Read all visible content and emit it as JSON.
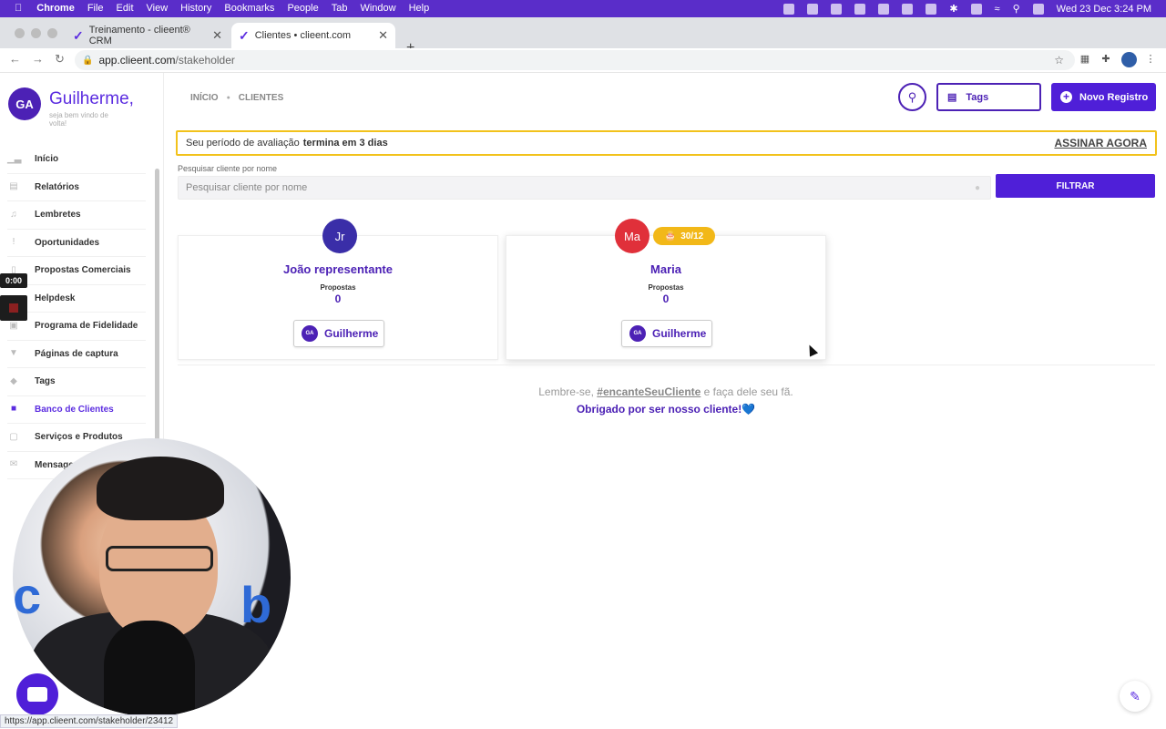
{
  "menubar": {
    "app": "Chrome",
    "items": [
      "File",
      "Edit",
      "View",
      "History",
      "Bookmarks",
      "People",
      "Tab",
      "Window",
      "Help"
    ],
    "clock": "Wed 23 Dec  3:24 PM"
  },
  "tabs": [
    {
      "title": "Treinamento - clieent® CRM",
      "active": false
    },
    {
      "title": "Clientes • clieent.com",
      "active": true
    }
  ],
  "address": {
    "host": "app.clieent.com",
    "path": "/stakeholder"
  },
  "sidebar": {
    "initials": "GA",
    "greeting": "Guilherme,",
    "subtitle": "seja bem vindo de volta!",
    "items": [
      {
        "label": "Início"
      },
      {
        "label": "Relatórios"
      },
      {
        "label": "Lembretes"
      },
      {
        "label": "Oportunidades"
      },
      {
        "label": "Propostas Comerciais"
      },
      {
        "label": "Helpdesk"
      },
      {
        "label": "Programa de Fidelidade"
      },
      {
        "label": "Páginas de captura"
      },
      {
        "label": "Tags"
      },
      {
        "label": "Banco de Clientes"
      },
      {
        "label": "Serviços e Produtos"
      },
      {
        "label": "Mensagem"
      }
    ],
    "active_index": 9
  },
  "recorder": {
    "time": "0:00"
  },
  "header": {
    "breadcrumb": [
      "INÍCIO",
      "CLIENTES"
    ],
    "tags_label": "Tags",
    "new_label": "Novo Registro"
  },
  "trial": {
    "text": "Seu período de avaliação",
    "bold": "termina em 3 dias",
    "cta": "ASSINAR AGORA"
  },
  "filter": {
    "label": "Pesquisar cliente por nome",
    "placeholder": "Pesquisar cliente por nome",
    "button": "FILTRAR"
  },
  "cards": [
    {
      "initials": "Jr",
      "name": "João representante",
      "proposals_label": "Propostas",
      "proposals": "0",
      "owner_initials": "GA",
      "owner": "Guilherme",
      "color": "#3a2ea8"
    },
    {
      "initials": "Ma",
      "name": "Maria",
      "proposals_label": "Propostas",
      "proposals": "0",
      "owner_initials": "GA",
      "owner": "Guilherme",
      "badge": "30/12",
      "color": "#e0303a"
    }
  ],
  "footer": {
    "line1_pre": "Lembre-se, ",
    "hashtag": "#encanteSeuCliente",
    "line1_post": " e faça dele seu fã.",
    "line2": "Obrigado por ser nosso cliente!",
    "heart": "💙"
  },
  "statusbar": "https://app.clieent.com/stakeholder/23412",
  "colors": {
    "brand": "#4f1fd8",
    "warning": "#f2c21b",
    "badge": "#f2b818"
  }
}
